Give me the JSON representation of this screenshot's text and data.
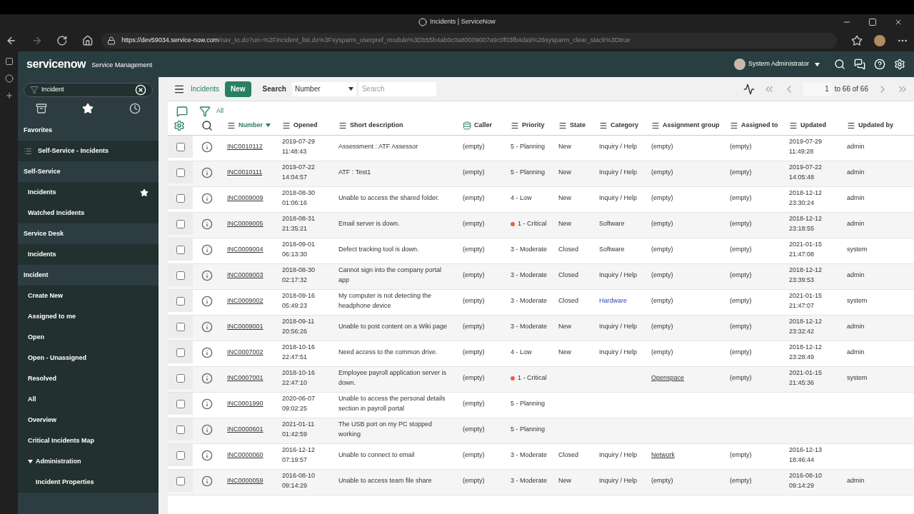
{
  "browser": {
    "tab_title": "Incidents | ServiceNow",
    "url_host": "https://dev59034.service-now.com",
    "url_path": "/nav_to.do?uri=%2Fincident_list.do%3Fsysparm_userpref_module%3Db55b4ab0c0a80009007a9c0f03fb4da9%26sysparm_clear_stack%3Dtrue"
  },
  "header": {
    "logo": "servicenow",
    "product": "Service Management",
    "user": "System Administrator"
  },
  "nav": {
    "filter": "Incident",
    "items": [
      {
        "kind": "section",
        "label": "Favorites"
      },
      {
        "kind": "favorite",
        "label": "Self-Service - Incidents"
      },
      {
        "kind": "section",
        "label": "Self-Service"
      },
      {
        "kind": "item",
        "label": "Incidents",
        "starred": true
      },
      {
        "kind": "item",
        "label": "Watched Incidents",
        "starred": false
      },
      {
        "kind": "section",
        "label": "Service Desk"
      },
      {
        "kind": "item",
        "label": "Incidents",
        "starred": false
      },
      {
        "kind": "section",
        "label": "Incident"
      },
      {
        "kind": "item",
        "label": "Create New",
        "starred": false
      },
      {
        "kind": "item",
        "label": "Assigned to me",
        "starred": false
      },
      {
        "kind": "item",
        "label": "Open",
        "starred": false
      },
      {
        "kind": "item",
        "label": "Open - Unassigned",
        "starred": false
      },
      {
        "kind": "item",
        "label": "Resolved",
        "starred": false
      },
      {
        "kind": "item",
        "label": "All",
        "starred": false
      },
      {
        "kind": "item",
        "label": "Overview",
        "starred": false
      },
      {
        "kind": "item",
        "label": "Critical Incidents Map",
        "starred": false
      },
      {
        "kind": "group",
        "label": "Administration",
        "expanded": true,
        "children": [
          {
            "label": "Incident Properties"
          }
        ]
      }
    ]
  },
  "list": {
    "title": "Incidents",
    "new_button": "New",
    "search_label": "Search",
    "search_field": "Number",
    "search_placeholder": "Search",
    "page": "1",
    "page_range": "to 66 of 66",
    "filter_label": "All",
    "columns": [
      {
        "kind": "field",
        "label": "Number",
        "sorted": true
      },
      {
        "kind": "field",
        "label": "Opened",
        "sorted": false
      },
      {
        "kind": "field",
        "label": "Short description",
        "sorted": false
      },
      {
        "kind": "reference",
        "label": "Caller",
        "sorted": false
      },
      {
        "kind": "field",
        "label": "Priority",
        "sorted": false
      },
      {
        "kind": "field",
        "label": "State",
        "sorted": false
      },
      {
        "kind": "field",
        "label": "Category",
        "sorted": false
      },
      {
        "kind": "field",
        "label": "Assignment group",
        "sorted": false
      },
      {
        "kind": "field",
        "label": "Assigned to",
        "sorted": false
      },
      {
        "kind": "field",
        "label": "Updated",
        "sorted": false
      },
      {
        "kind": "field",
        "label": "Updated by",
        "sorted": false
      }
    ],
    "rows": [
      {
        "checked": false,
        "cells": [
          {
            "kind": "link",
            "text": "INC0010112"
          },
          {
            "kind": "text",
            "text": "2019-07-29 11:48:43"
          },
          {
            "kind": "text",
            "text": "Assessment : ATF Assessor"
          },
          {
            "kind": "text",
            "text": "(empty)"
          },
          {
            "kind": "text",
            "text": "5 - Planning"
          },
          {
            "kind": "text",
            "text": "New"
          },
          {
            "kind": "text",
            "text": "Inquiry / Help"
          },
          {
            "kind": "text",
            "text": "(empty)"
          },
          {
            "kind": "text",
            "text": "(empty)"
          },
          {
            "kind": "text",
            "text": "2019-07-29 11:49:28"
          },
          {
            "kind": "text",
            "text": "admin"
          }
        ]
      },
      {
        "checked": false,
        "cells": [
          {
            "kind": "link",
            "text": "INC0010111"
          },
          {
            "kind": "text",
            "text": "2019-07-22 14:04:57"
          },
          {
            "kind": "text",
            "text": "ATF : Test1"
          },
          {
            "kind": "text",
            "text": "(empty)"
          },
          {
            "kind": "text",
            "text": "5 - Planning"
          },
          {
            "kind": "text",
            "text": "New"
          },
          {
            "kind": "text",
            "text": "Inquiry / Help"
          },
          {
            "kind": "text",
            "text": "(empty)"
          },
          {
            "kind": "text",
            "text": "(empty)"
          },
          {
            "kind": "text",
            "text": "2019-07-22 14:05:48"
          },
          {
            "kind": "text",
            "text": "admin"
          }
        ]
      },
      {
        "checked": false,
        "cells": [
          {
            "kind": "link",
            "text": "INC0009009"
          },
          {
            "kind": "text",
            "text": "2018-08-30 01:06:16"
          },
          {
            "kind": "text",
            "text": "Unable to access the shared folder."
          },
          {
            "kind": "text",
            "text": "(empty)"
          },
          {
            "kind": "text",
            "text": "4 - Low"
          },
          {
            "kind": "text",
            "text": "New"
          },
          {
            "kind": "text",
            "text": "Inquiry / Help"
          },
          {
            "kind": "text",
            "text": "(empty)"
          },
          {
            "kind": "text",
            "text": "(empty)"
          },
          {
            "kind": "text",
            "text": "2018-12-12 23:30:24"
          },
          {
            "kind": "text",
            "text": "admin"
          }
        ]
      },
      {
        "checked": false,
        "cells": [
          {
            "kind": "link",
            "text": "INC0009005"
          },
          {
            "kind": "text",
            "text": "2018-08-31 21:35:21"
          },
          {
            "kind": "text",
            "text": "Email server is down."
          },
          {
            "kind": "text",
            "text": "(empty)"
          },
          {
            "kind": "dot",
            "text": "1 - Critical",
            "color": "#e8604c"
          },
          {
            "kind": "text",
            "text": "New"
          },
          {
            "kind": "text",
            "text": "Software"
          },
          {
            "kind": "text",
            "text": "(empty)"
          },
          {
            "kind": "text",
            "text": "(empty)"
          },
          {
            "kind": "text",
            "text": "2018-12-12 23:18:55"
          },
          {
            "kind": "text",
            "text": "admin"
          }
        ]
      },
      {
        "checked": false,
        "cells": [
          {
            "kind": "link",
            "text": "INC0009004"
          },
          {
            "kind": "text",
            "text": "2018-09-01 06:13:30"
          },
          {
            "kind": "text",
            "text": "Defect tracking tool is down."
          },
          {
            "kind": "text",
            "text": "(empty)"
          },
          {
            "kind": "text",
            "text": "3 - Moderate"
          },
          {
            "kind": "text",
            "text": "Closed"
          },
          {
            "kind": "text",
            "text": "Software"
          },
          {
            "kind": "text",
            "text": "(empty)"
          },
          {
            "kind": "text",
            "text": "(empty)"
          },
          {
            "kind": "text",
            "text": "2021-01-15 21:47:08"
          },
          {
            "kind": "text",
            "text": "system"
          }
        ]
      },
      {
        "checked": false,
        "cells": [
          {
            "kind": "link",
            "text": "INC0009003"
          },
          {
            "kind": "text",
            "text": "2018-08-30 02:17:32"
          },
          {
            "kind": "text",
            "text": "Cannot sign into the company portal app"
          },
          {
            "kind": "text",
            "text": "(empty)"
          },
          {
            "kind": "text",
            "text": "3 - Moderate"
          },
          {
            "kind": "text",
            "text": "Closed"
          },
          {
            "kind": "text",
            "text": "Inquiry / Help"
          },
          {
            "kind": "text",
            "text": "(empty)"
          },
          {
            "kind": "text",
            "text": "(empty)"
          },
          {
            "kind": "text",
            "text": "2018-12-12 23:39:53"
          },
          {
            "kind": "text",
            "text": "admin"
          }
        ]
      },
      {
        "checked": false,
        "cells": [
          {
            "kind": "link",
            "text": "INC0009002"
          },
          {
            "kind": "text",
            "text": "2018-09-16 05:49:23"
          },
          {
            "kind": "text",
            "text": "My computer is not detecting the headphone device"
          },
          {
            "kind": "text",
            "text": "(empty)"
          },
          {
            "kind": "text",
            "text": "3 - Moderate"
          },
          {
            "kind": "text",
            "text": "Closed"
          },
          {
            "kind": "visited",
            "text": "Hardware"
          },
          {
            "kind": "text",
            "text": "(empty)"
          },
          {
            "kind": "text",
            "text": "(empty)"
          },
          {
            "kind": "text",
            "text": "2021-01-15 21:47:07"
          },
          {
            "kind": "text",
            "text": "system"
          }
        ]
      },
      {
        "checked": false,
        "cells": [
          {
            "kind": "link",
            "text": "INC0009001"
          },
          {
            "kind": "text",
            "text": "2018-09-11 20:56:26"
          },
          {
            "kind": "text",
            "text": "Unable to post content on a Wiki page"
          },
          {
            "kind": "text",
            "text": "(empty)"
          },
          {
            "kind": "text",
            "text": "3 - Moderate"
          },
          {
            "kind": "text",
            "text": "New"
          },
          {
            "kind": "text",
            "text": "Inquiry / Help"
          },
          {
            "kind": "text",
            "text": "(empty)"
          },
          {
            "kind": "text",
            "text": "(empty)"
          },
          {
            "kind": "text",
            "text": "2018-12-12 23:32:42"
          },
          {
            "kind": "text",
            "text": "admin"
          }
        ]
      },
      {
        "checked": false,
        "cells": [
          {
            "kind": "link",
            "text": "INC0007002"
          },
          {
            "kind": "text",
            "text": "2018-10-16 22:47:51"
          },
          {
            "kind": "text",
            "text": "Need access to the common drive."
          },
          {
            "kind": "text",
            "text": "(empty)"
          },
          {
            "kind": "text",
            "text": "4 - Low"
          },
          {
            "kind": "text",
            "text": "New"
          },
          {
            "kind": "text",
            "text": "Inquiry / Help"
          },
          {
            "kind": "text",
            "text": "(empty)"
          },
          {
            "kind": "text",
            "text": "(empty)"
          },
          {
            "kind": "text",
            "text": "2018-12-12 23:28:49"
          },
          {
            "kind": "text",
            "text": "admin"
          }
        ]
      },
      {
        "checked": false,
        "cells": [
          {
            "kind": "link",
            "text": "INC0007001"
          },
          {
            "kind": "text",
            "text": "2018-10-16 22:47:10"
          },
          {
            "kind": "text",
            "text": "Employee payroll application server is down."
          },
          {
            "kind": "text",
            "text": "(empty)"
          },
          {
            "kind": "dot",
            "text": "1 - Critical",
            "color": "#e8604c"
          },
          null,
          null,
          {
            "kind": "link",
            "text": "Openspace"
          },
          {
            "kind": "text",
            "text": "(empty)"
          },
          {
            "kind": "text",
            "text": "2021-01-15 21:45:36"
          },
          {
            "kind": "text",
            "text": "system"
          }
        ]
      },
      {
        "checked": false,
        "cells": [
          {
            "kind": "link",
            "text": "INC0001990"
          },
          {
            "kind": "text",
            "text": "2020-06-07 09:02:25"
          },
          {
            "kind": "text",
            "text": "Unable to access the personal details section in payroll portal"
          },
          {
            "kind": "text",
            "text": "(empty)"
          },
          {
            "kind": "text",
            "text": "5 - Planning"
          },
          null,
          null,
          null,
          null,
          null,
          null
        ]
      },
      {
        "checked": false,
        "cells": [
          {
            "kind": "link",
            "text": "INC0000601"
          },
          {
            "kind": "text",
            "text": "2021-01-11 01:42:59"
          },
          {
            "kind": "text",
            "text": "The USB port on my PC stopped working"
          },
          {
            "kind": "text",
            "text": "(empty)"
          },
          {
            "kind": "text",
            "text": "5 - Planning"
          },
          null,
          null,
          null,
          null,
          null,
          null
        ]
      },
      {
        "checked": false,
        "cells": [
          {
            "kind": "link",
            "text": "INC0000060"
          },
          {
            "kind": "text",
            "text": "2016-12-12 07:19:57"
          },
          {
            "kind": "text",
            "text": "Unable to connect to email"
          },
          {
            "kind": "text",
            "text": "(empty)"
          },
          {
            "kind": "text",
            "text": "3 - Moderate"
          },
          {
            "kind": "text",
            "text": "Closed"
          },
          {
            "kind": "text",
            "text": "Inquiry / Help"
          },
          {
            "kind": "link",
            "text": "Network"
          },
          {
            "kind": "text",
            "text": "(empty)"
          },
          {
            "kind": "text",
            "text": "2016-12-13 18:46:44"
          },
          null
        ]
      },
      {
        "checked": false,
        "cells": [
          {
            "kind": "link",
            "text": "INC0000059"
          },
          {
            "kind": "text",
            "text": "2016-08-10 09:14:29"
          },
          {
            "kind": "text",
            "text": "Unable to access team file share"
          },
          {
            "kind": "text",
            "text": "(empty)"
          },
          {
            "kind": "text",
            "text": "3 - Moderate"
          },
          {
            "kind": "text",
            "text": "New"
          },
          {
            "kind": "text",
            "text": "Inquiry / Help"
          },
          {
            "kind": "text",
            "text": "(empty)"
          },
          {
            "kind": "text",
            "text": "(empty)"
          },
          {
            "kind": "text",
            "text": "2016-08-10 09:14:29"
          },
          {
            "kind": "text",
            "text": "admin"
          }
        ]
      }
    ]
  }
}
